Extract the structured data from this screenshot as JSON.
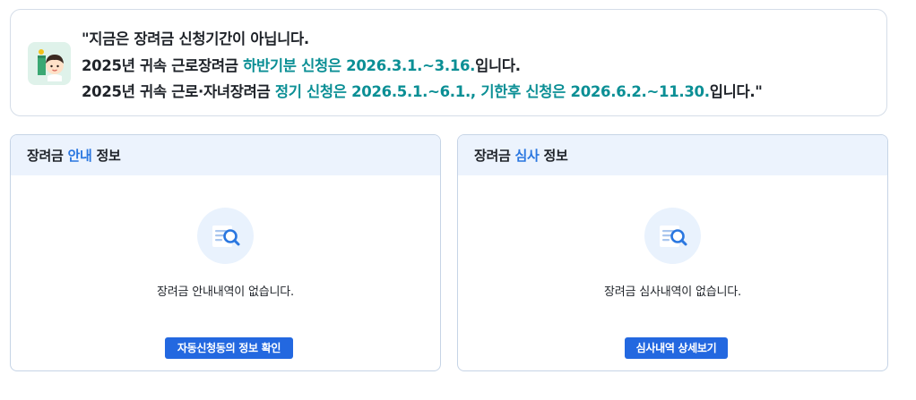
{
  "notice": {
    "avatar_icon": "child-character-icon",
    "line1": "\"지금은 장려금 신청기간이 아닙니다.",
    "line2_prefix": "2025년 귀속 근로장려금 ",
    "line2_highlight": "하반기분 신청은 2026.3.1.~3.16.",
    "line2_suffix": "입니다.",
    "line3_prefix": "2025년 귀속 근로·자녀장려금 ",
    "line3_highlight": "정기 신청은 2026.5.1.~6.1., 기한후 신청은 2026.6.2.~11.30.",
    "line3_suffix": "입니다.\""
  },
  "panels": {
    "guide": {
      "title_prefix": "장려금",
      "title_accent": "안내",
      "title_suffix": "정보",
      "empty_icon": "document-search-icon",
      "empty_message": "장려금 안내내역이 없습니다.",
      "button_label": "자동신청동의 정보 확인"
    },
    "review": {
      "title_prefix": "장려금",
      "title_accent": "심사",
      "title_suffix": "정보",
      "empty_icon": "document-search-icon",
      "empty_message": "장려금 심사내역이 없습니다.",
      "button_label": "심사내역 상세보기"
    }
  },
  "colors": {
    "highlight": "#0b8f95",
    "accent": "#2a77e0",
    "button": "#2368e0",
    "panel_header": "#ecf3fd"
  }
}
